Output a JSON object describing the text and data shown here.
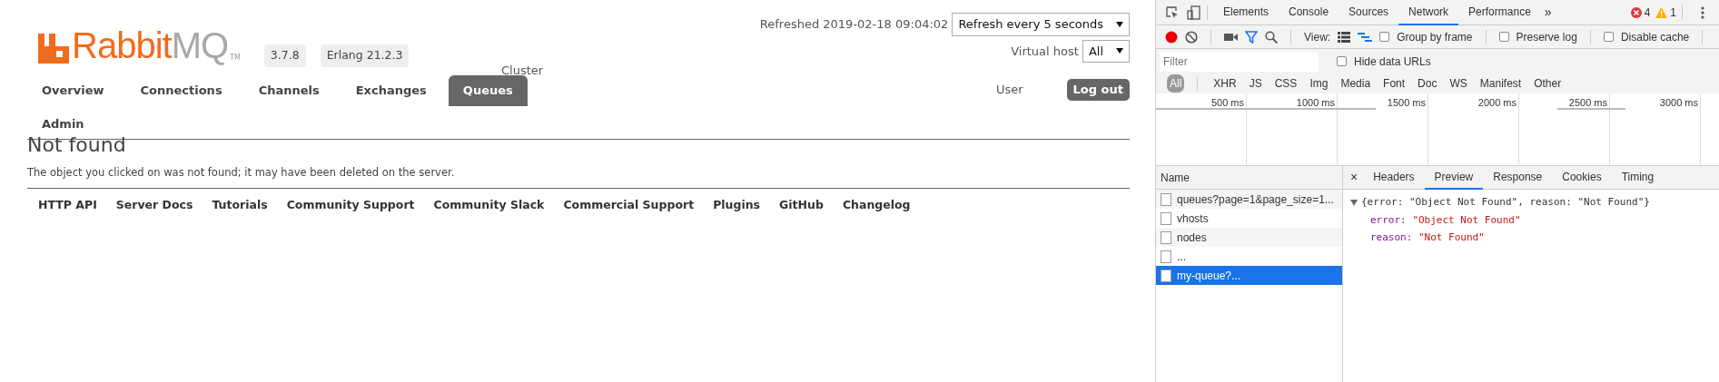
{
  "header": {
    "logo_a": "Rabbit",
    "logo_b": "MQ",
    "logo_tm": "TM",
    "version": "3.7.8",
    "erlang": "Erlang 21.2.3",
    "refreshed": "Refreshed 2019-02-18 09:04:02",
    "refresh_select": "Refresh every 5 seconds",
    "vhost_label": "Virtual host",
    "vhost_select": "All",
    "cluster_label": "Cluster",
    "user_label": "User",
    "logout": "Log out"
  },
  "nav": [
    {
      "label": "Overview",
      "selected": false
    },
    {
      "label": "Connections",
      "selected": false
    },
    {
      "label": "Channels",
      "selected": false
    },
    {
      "label": "Exchanges",
      "selected": false
    },
    {
      "label": "Queues",
      "selected": true
    },
    {
      "label": "Admin",
      "selected": false
    }
  ],
  "page": {
    "heading": "Not found",
    "message": "The object you clicked on was not found; it may have been deleted on the server."
  },
  "footer_links": [
    "HTTP API",
    "Server Docs",
    "Tutorials",
    "Community Support",
    "Community Slack",
    "Commercial Support",
    "Plugins",
    "GitHub",
    "Changelog"
  ],
  "devtools": {
    "tabs": [
      {
        "label": "Elements",
        "selected": false
      },
      {
        "label": "Console",
        "selected": false
      },
      {
        "label": "Sources",
        "selected": false
      },
      {
        "label": "Network",
        "selected": true
      },
      {
        "label": "Performance",
        "selected": false
      }
    ],
    "more_tabs": "»",
    "errors": "4",
    "warnings": "1",
    "view_label": "View:",
    "options": [
      {
        "label": "Group by frame",
        "checked": false
      },
      {
        "label": "Preserve log",
        "checked": false
      },
      {
        "label": "Disable cache",
        "checked": false
      }
    ],
    "filter": {
      "placeholder": "Filter"
    },
    "hide_data_urls": {
      "label": "Hide data URLs",
      "checked": false
    },
    "types": [
      {
        "label": "All",
        "selected": true
      },
      {
        "label": "XHR",
        "selected": false
      },
      {
        "label": "JS",
        "selected": false
      },
      {
        "label": "CSS",
        "selected": false
      },
      {
        "label": "Img",
        "selected": false
      },
      {
        "label": "Media",
        "selected": false
      },
      {
        "label": "Font",
        "selected": false
      },
      {
        "label": "Doc",
        "selected": false
      },
      {
        "label": "WS",
        "selected": false
      },
      {
        "label": "Manifest",
        "selected": false
      },
      {
        "label": "Other",
        "selected": false
      }
    ],
    "timeline_ticks": [
      "500 ms",
      "1000 ms",
      "1500 ms",
      "2000 ms",
      "2500 ms",
      "3000 ms"
    ],
    "name_header": "Name",
    "requests": [
      {
        "name": "queues?page=1&page_size=1...",
        "selected": false
      },
      {
        "name": "vhosts",
        "selected": false
      },
      {
        "name": "nodes",
        "selected": false
      },
      {
        "name": "...",
        "selected": false
      },
      {
        "name": "my-queue?...",
        "selected": true
      }
    ],
    "close": "×",
    "detail_tabs": [
      {
        "label": "Headers",
        "selected": false
      },
      {
        "label": "Preview",
        "selected": true
      },
      {
        "label": "Response",
        "selected": false
      },
      {
        "label": "Cookies",
        "selected": false
      },
      {
        "label": "Timing",
        "selected": false
      }
    ],
    "preview": {
      "expanded": true,
      "summary": "{error: \"Object Not Found\", reason: \"Not Found\"}",
      "properties": [
        {
          "key": "error:",
          "value": "\"Object Not Found\""
        },
        {
          "key": "reason:",
          "value": "\"Not Found\""
        }
      ]
    }
  }
}
